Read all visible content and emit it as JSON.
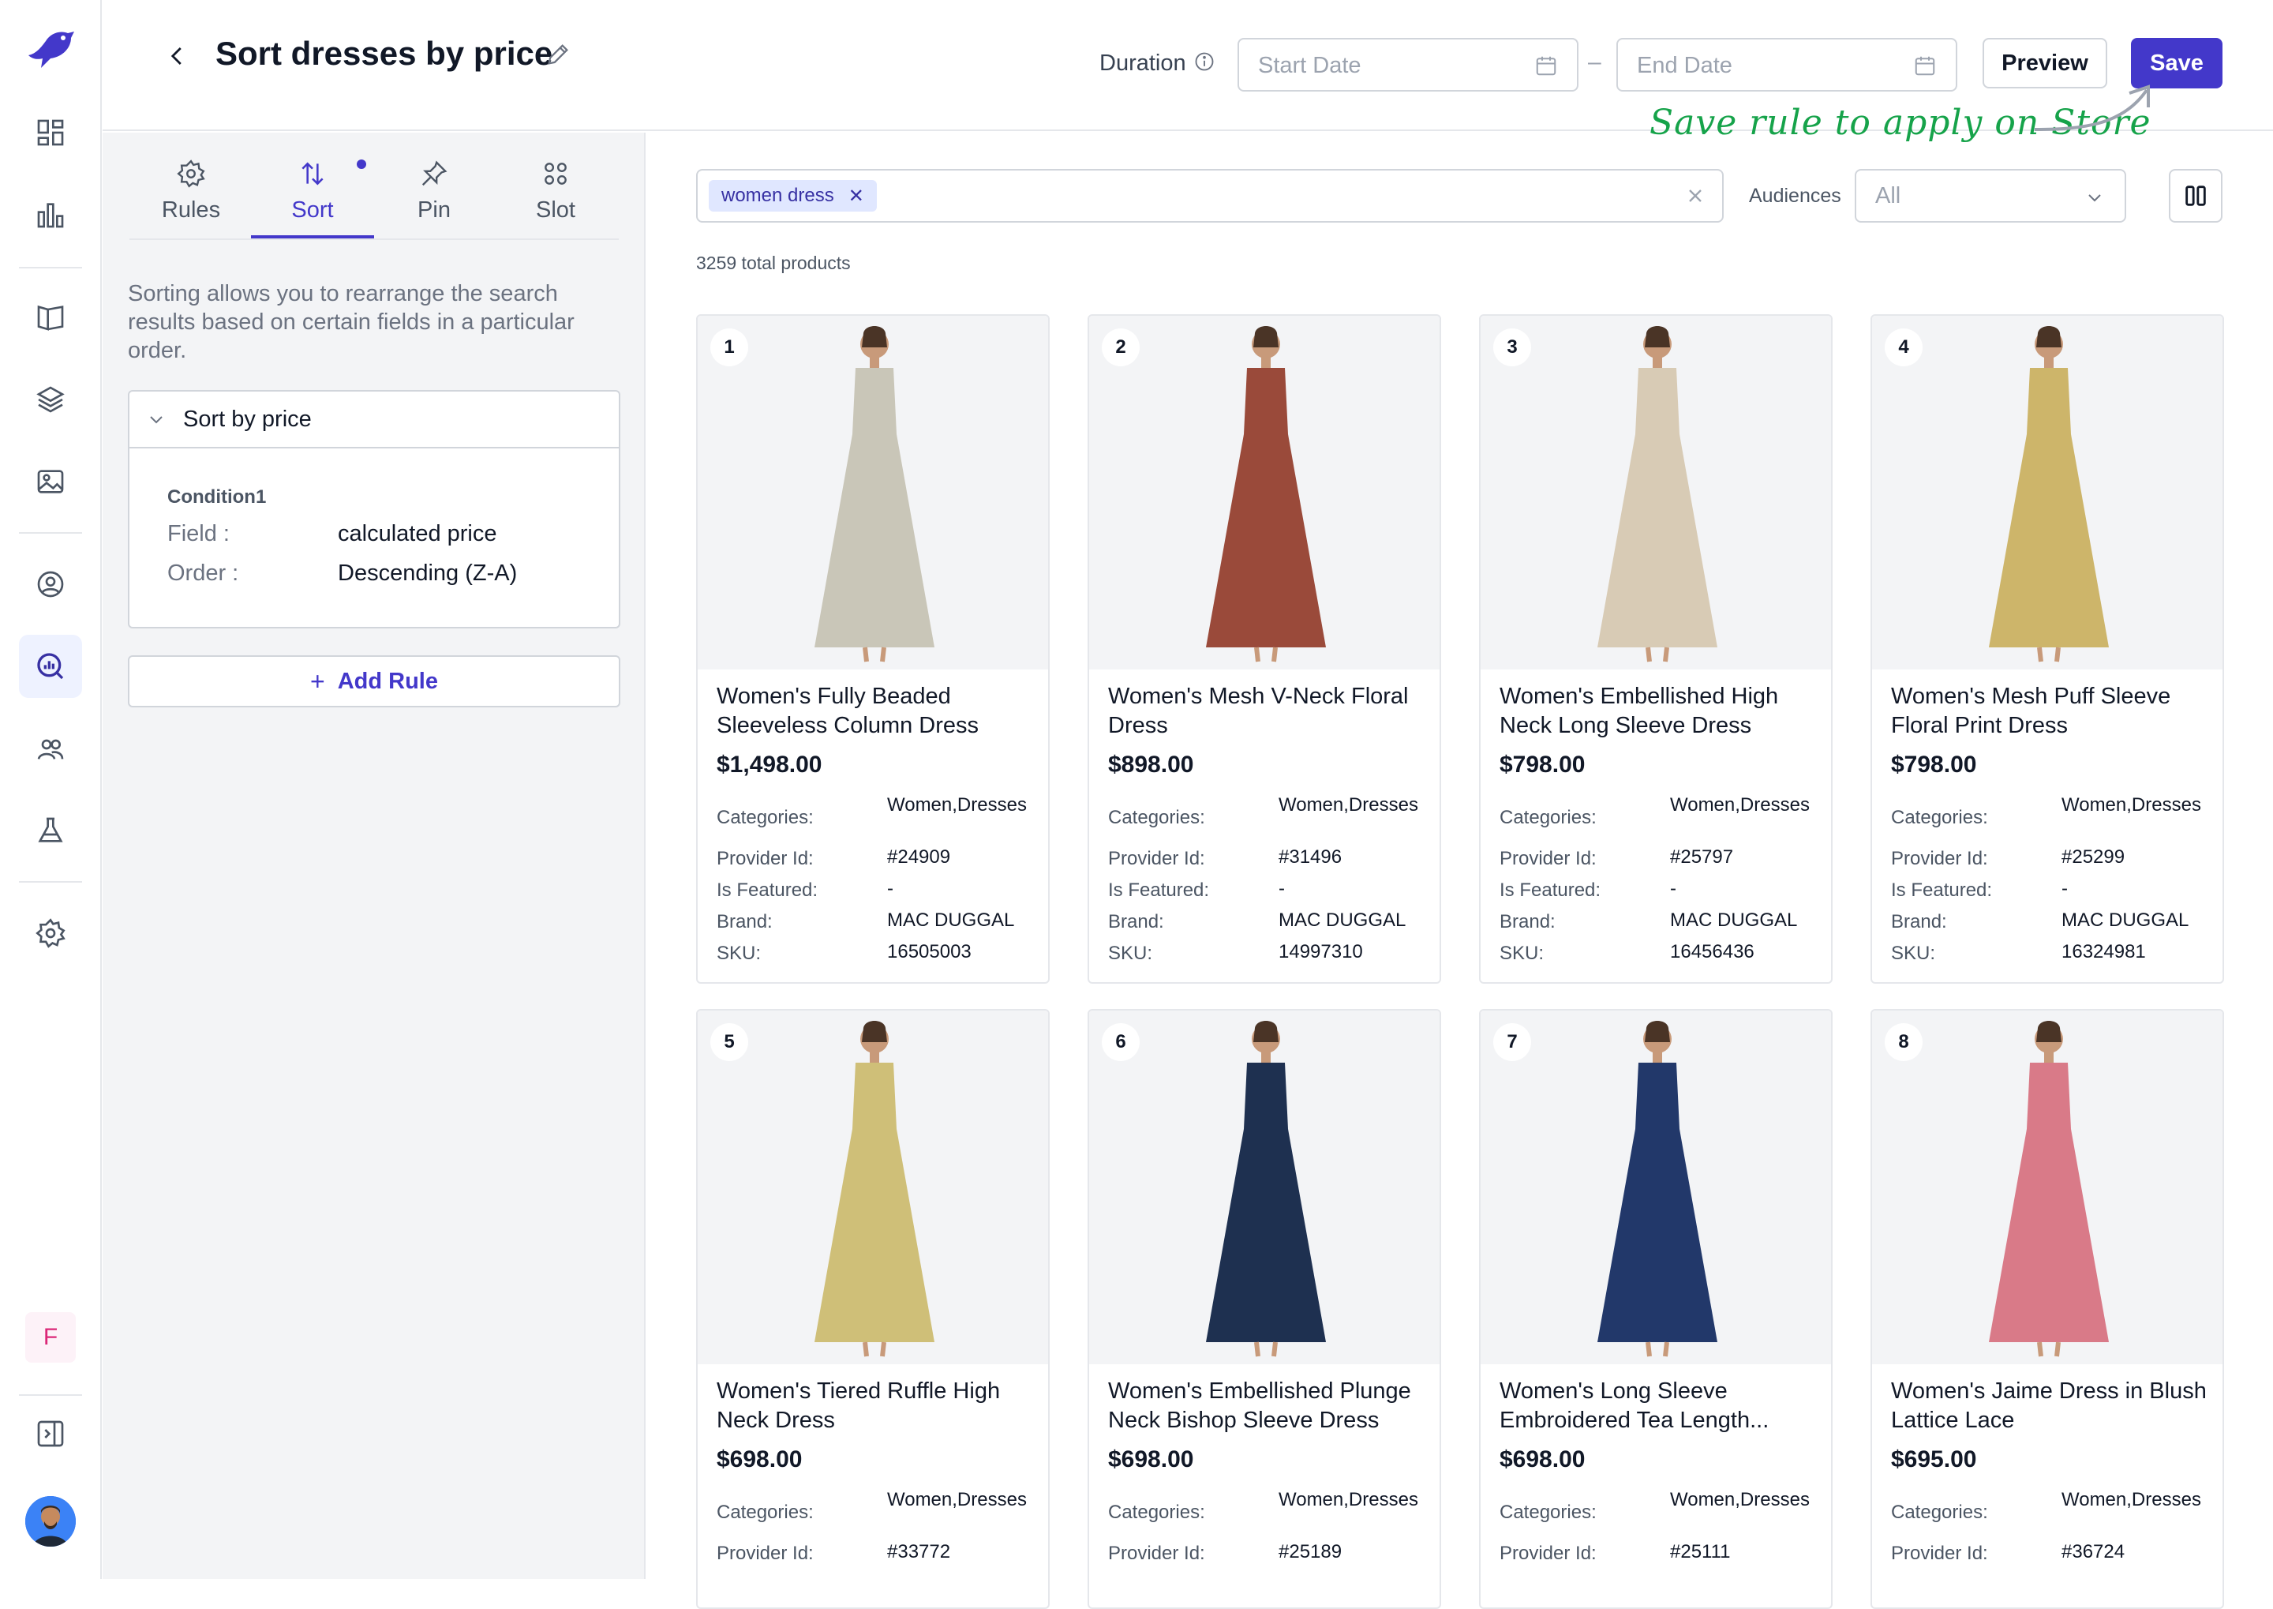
{
  "header": {
    "title": "Sort dresses by price",
    "duration_label": "Duration",
    "start_date_placeholder": "Start Date",
    "end_date_placeholder": "End Date",
    "preview_label": "Preview",
    "save_label": "Save",
    "annotation": "Save rule to apply on Store"
  },
  "sidebar": {
    "icons": [
      "bird-logo-icon",
      "dashboard-icon",
      "analytics-icon",
      "catalog-icon",
      "layers-icon",
      "image-icon",
      "user-circle-icon",
      "search-insights-icon",
      "users-icon",
      "flask-icon",
      "settings-icon"
    ],
    "workspace_initial": "F",
    "active_item": "search-insights-icon"
  },
  "left_panel": {
    "tabs": [
      {
        "label": "Rules",
        "icon": "gear-icon"
      },
      {
        "label": "Sort",
        "icon": "sort-arrows-icon"
      },
      {
        "label": "Pin",
        "icon": "pin-icon"
      },
      {
        "label": "Slot",
        "icon": "grid-dots-icon"
      }
    ],
    "active_tab": "Sort",
    "description": "Sorting allows you to rearrange the search results based on certain fields in a particular order.",
    "rule": {
      "name": "Sort by price",
      "condition_title": "Condition1",
      "field_label": "Field :",
      "field_value": "calculated price",
      "order_label": "Order :",
      "order_value": "Descending (Z-A)"
    },
    "add_rule_label": "Add Rule"
  },
  "toolbar": {
    "query_chip": "women dress",
    "audiences_label": "Audiences",
    "audiences_value": "All",
    "total_products": "3259 total products"
  },
  "labels": {
    "categories": "Categories:",
    "provider_id": "Provider Id:",
    "is_featured": "Is Featured:",
    "brand": "Brand:",
    "sku": "SKU:"
  },
  "products": [
    {
      "rank": "1",
      "name": "Women's Fully Beaded Sleeveless Column Dress",
      "price": "$1,498.00",
      "categories": "Women,Dresses",
      "provider_id": "#24909",
      "is_featured": "-",
      "brand": "MAC DUGGAL",
      "sku": "16505003",
      "color": "#c9c6b8"
    },
    {
      "rank": "2",
      "name": "Women's Mesh V-Neck Floral Dress",
      "price": "$898.00",
      "categories": "Women,Dresses",
      "provider_id": "#31496",
      "is_featured": "-",
      "brand": "MAC DUGGAL",
      "sku": "14997310",
      "color": "#9a4a3a"
    },
    {
      "rank": "3",
      "name": "Women's Embellished High Neck Long Sleeve Dress",
      "price": "$798.00",
      "categories": "Women,Dresses",
      "provider_id": "#25797",
      "is_featured": "-",
      "brand": "MAC DUGGAL",
      "sku": "16456436",
      "color": "#d8cbb5"
    },
    {
      "rank": "4",
      "name": "Women's Mesh Puff Sleeve Floral Print Dress",
      "price": "$798.00",
      "categories": "Women,Dresses",
      "provider_id": "#25299",
      "is_featured": "-",
      "brand": "MAC DUGGAL",
      "sku": "16324981",
      "color": "#cdb56a"
    },
    {
      "rank": "5",
      "name": "Women's Tiered Ruffle High Neck Dress",
      "price": "$698.00",
      "categories": "Women,Dresses",
      "provider_id": "#33772",
      "color": "#cfbf78"
    },
    {
      "rank": "6",
      "name": "Women's Embellished Plunge Neck Bishop Sleeve Dress",
      "price": "$698.00",
      "categories": "Women,Dresses",
      "provider_id": "#25189",
      "color": "#1e3050"
    },
    {
      "rank": "7",
      "name": "Women's Long Sleeve Embroidered Tea Length...",
      "price": "$698.00",
      "categories": "Women,Dresses",
      "provider_id": "#25111",
      "color": "#22386a"
    },
    {
      "rank": "8",
      "name": "Women's Jaime Dress in Blush Lattice Lace",
      "price": "$695.00",
      "categories": "Women,Dresses",
      "provider_id": "#36724",
      "color": "#d97a88"
    }
  ]
}
